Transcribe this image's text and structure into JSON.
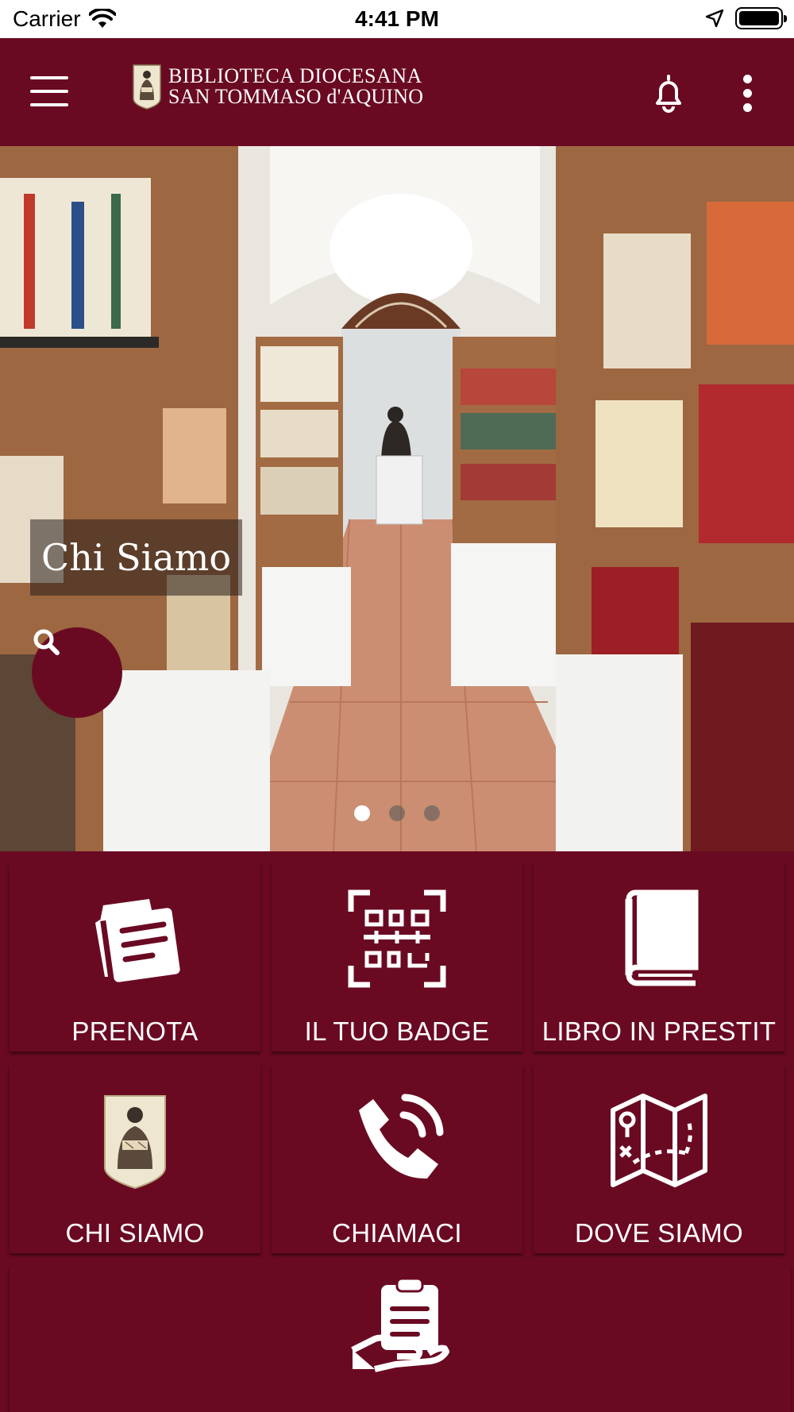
{
  "status_bar": {
    "carrier": "Carrier",
    "time": "4:41 PM"
  },
  "app_bar": {
    "logo_line1": "BIBLIOTECA DIOCESANA",
    "logo_line2": "SAN TOMMASO d'AQUINO"
  },
  "hero": {
    "caption": "Chi Siamo",
    "slides_total": 3,
    "active_slide": 1
  },
  "tiles": [
    {
      "label": "PRENOTA",
      "icon": "notes-icon"
    },
    {
      "label": "IL TUO BADGE",
      "icon": "qr-code-icon"
    },
    {
      "label": "LIBRO IN PRESTIT",
      "icon": "book-icon"
    },
    {
      "label": "CHI SIAMO",
      "icon": "saint-emblem-icon"
    },
    {
      "label": "CHIAMACI",
      "icon": "phone-icon"
    },
    {
      "label": "DOVE SIAMO",
      "icon": "map-icon"
    },
    {
      "label": "",
      "icon": "clipboard-hand-icon"
    }
  ],
  "colors": {
    "brand": "#6a0a22",
    "on_brand": "#ffffff"
  }
}
